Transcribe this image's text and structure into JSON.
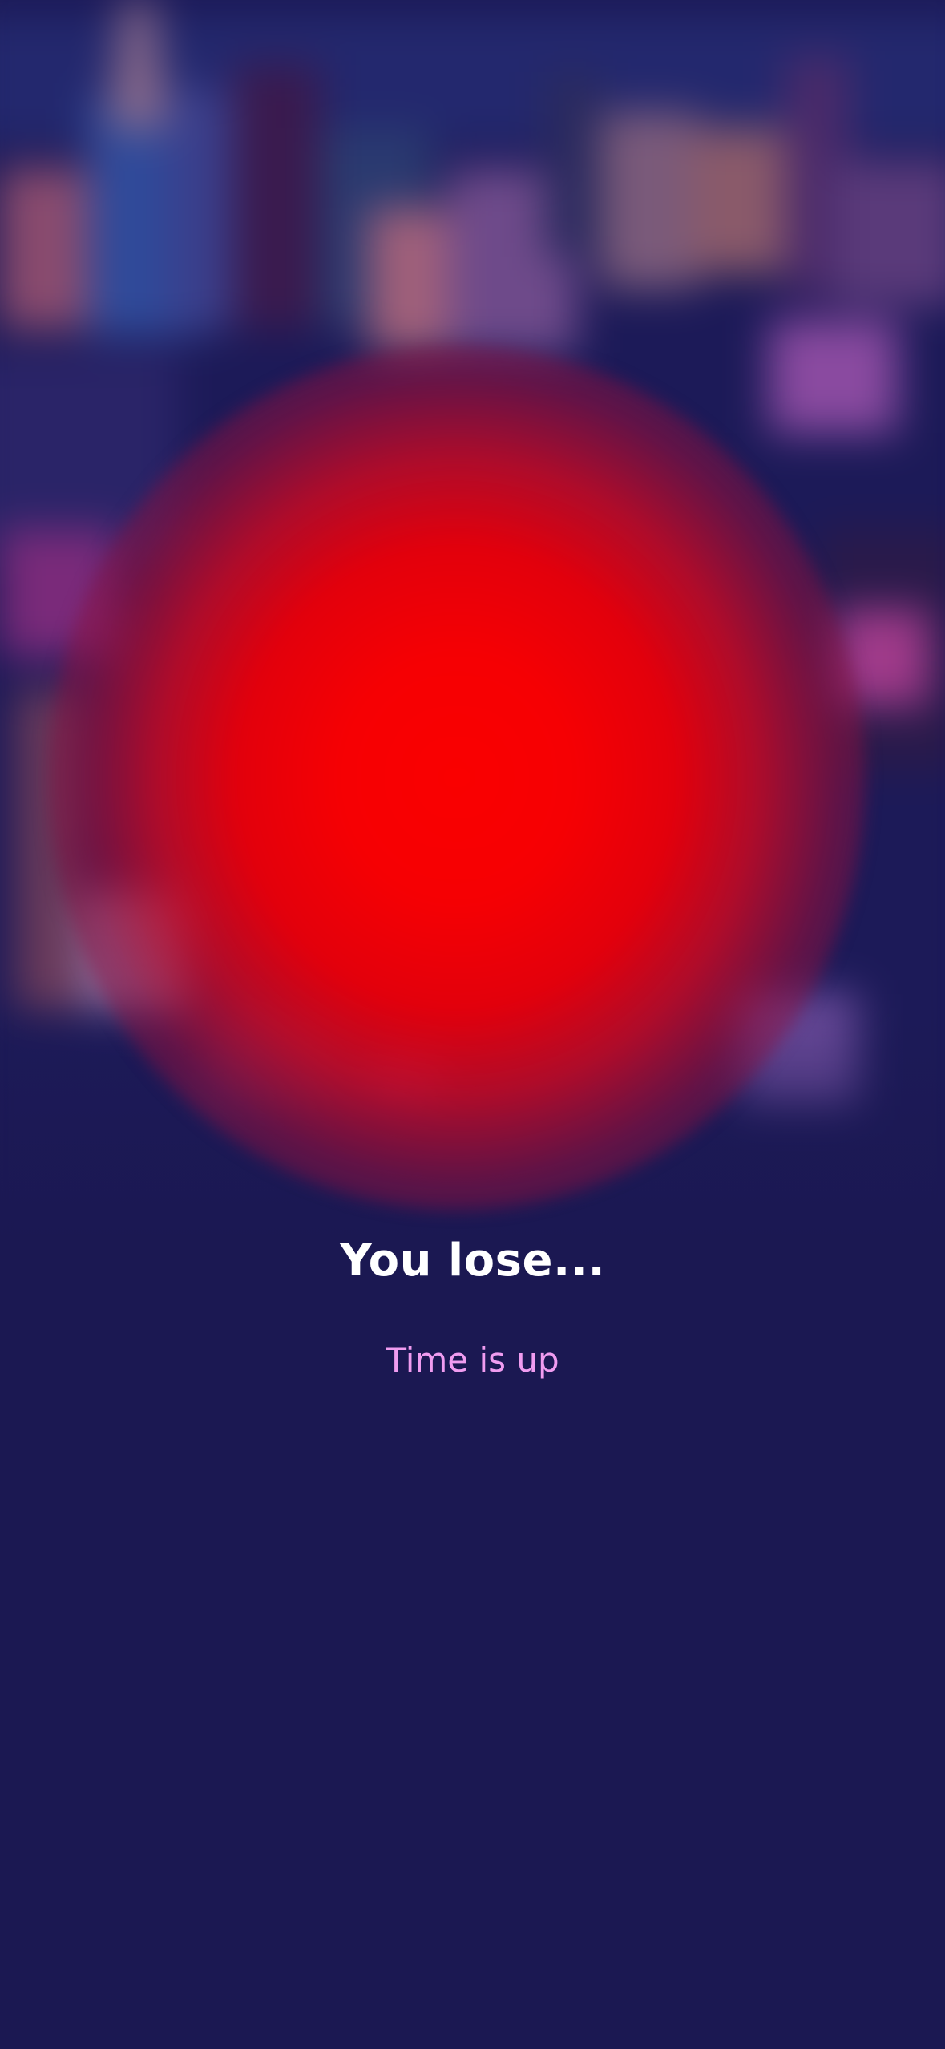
{
  "result": {
    "title": "You lose...",
    "message": "Time is up"
  },
  "colors": {
    "background": "#1b1852",
    "glow": "#fa0000",
    "title": "#ffffff",
    "message": "#f09cf0"
  }
}
